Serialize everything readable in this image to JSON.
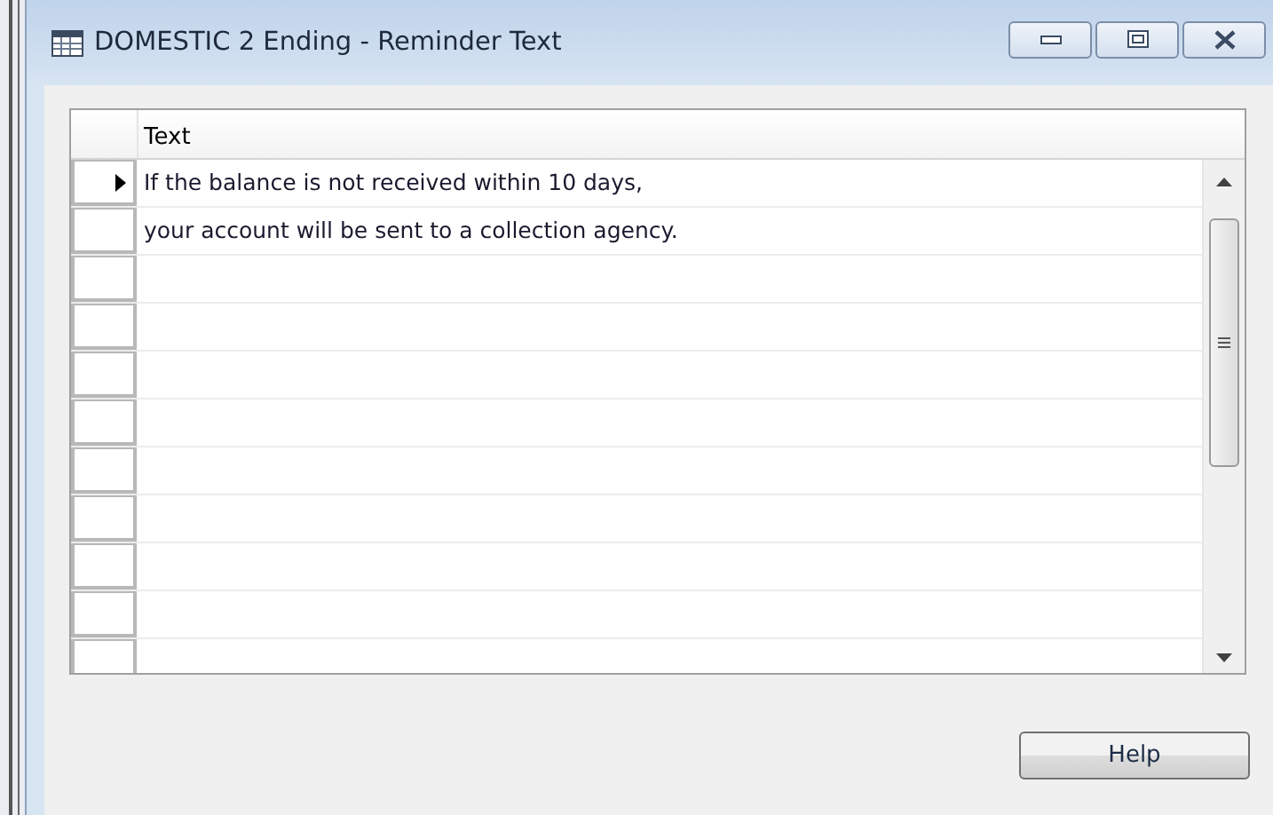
{
  "window": {
    "title": "DOMESTIC 2 Ending - Reminder Text"
  },
  "table": {
    "columns": [
      "Text"
    ],
    "rows": [
      {
        "current": true,
        "text": "If the balance is not received within 10 days,"
      },
      {
        "current": false,
        "text": "your account will be sent to a collection agency."
      },
      {
        "current": false
      },
      {
        "current": false
      },
      {
        "current": false
      },
      {
        "current": false
      },
      {
        "current": false
      },
      {
        "current": false
      },
      {
        "current": false
      },
      {
        "current": false
      },
      {
        "current": false
      }
    ]
  },
  "buttons": [
    "Help"
  ]
}
